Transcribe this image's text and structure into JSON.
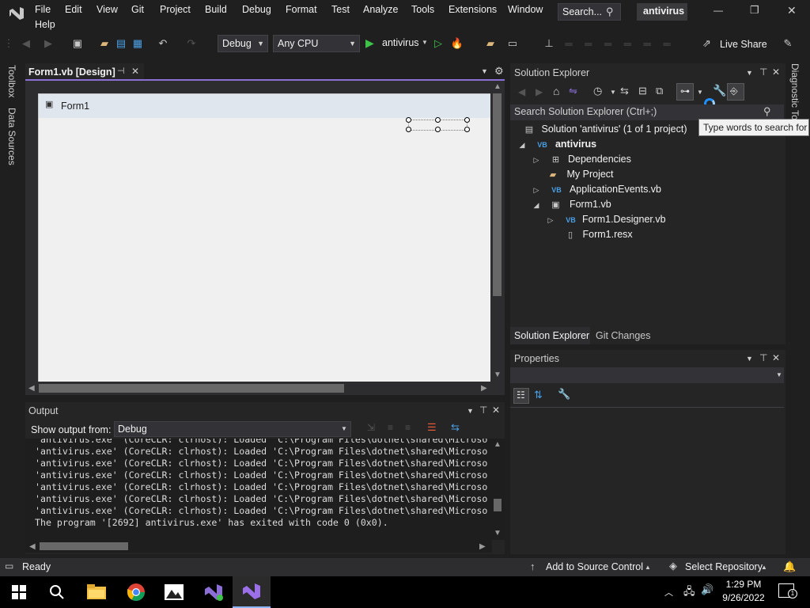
{
  "menu": [
    "File",
    "Edit",
    "View",
    "Git",
    "Project",
    "Build",
    "Debug",
    "Format",
    "Test",
    "Analyze",
    "Tools",
    "Extensions",
    "Window",
    "Help"
  ],
  "search": {
    "label": "Search..."
  },
  "solution_name": "antivirus",
  "window_controls": {
    "minimize": "—",
    "restore": "❐",
    "close": "✕"
  },
  "toolbar": {
    "config": "Debug",
    "platform": "Any CPU",
    "start": "antivirus",
    "live_share": "Live Share"
  },
  "side_tabs_left": [
    "Toolbox",
    "Data Sources"
  ],
  "side_tab_right": "Diagnostic To",
  "doc_tab": {
    "title": "Form1.vb [Design]",
    "pin": "⊣",
    "close": "✕"
  },
  "form_designer": {
    "form_title": "Form1"
  },
  "output": {
    "title": "Output",
    "show_from_label": "Show output from:",
    "source": "Debug",
    "lines": [
      "'antivirus.exe' (CoreCLR: clrhost): Loaded 'C:\\Program Files\\dotnet\\shared\\Microso",
      "'antivirus.exe' (CoreCLR: clrhost): Loaded 'C:\\Program Files\\dotnet\\shared\\Microso",
      "'antivirus.exe' (CoreCLR: clrhost): Loaded 'C:\\Program Files\\dotnet\\shared\\Microso",
      "'antivirus.exe' (CoreCLR: clrhost): Loaded 'C:\\Program Files\\dotnet\\shared\\Microso",
      "'antivirus.exe' (CoreCLR: clrhost): Loaded 'C:\\Program Files\\dotnet\\shared\\Microso",
      "'antivirus.exe' (CoreCLR: clrhost): Loaded 'C:\\Program Files\\dotnet\\shared\\Microso",
      "'antivirus.exe' (CoreCLR: clrhost): Loaded 'C:\\Program Files\\dotnet\\shared\\Microso",
      "The program '[2692] antivirus.exe' has exited with code 0 (0x0)."
    ]
  },
  "solution_explorer": {
    "title": "Solution Explorer",
    "search_placeholder": "Search Solution Explorer (Ctrl+;)",
    "tooltip": "Type words to search for",
    "solution_label": "Solution 'antivirus' (1 of 1 project)",
    "project": "antivirus",
    "items": [
      {
        "label": "Dependencies",
        "icon": "dependencies-icon"
      },
      {
        "label": "My Project",
        "icon": "folder-icon"
      },
      {
        "label": "ApplicationEvents.vb",
        "icon": "vb-file-icon"
      },
      {
        "label": "Form1.vb",
        "icon": "form-icon"
      },
      {
        "label": "Form1.Designer.vb",
        "icon": "vb-file-icon"
      },
      {
        "label": "Form1.resx",
        "icon": "resx-icon"
      }
    ],
    "bottom_tabs": [
      "Solution Explorer",
      "Git Changes"
    ]
  },
  "properties": {
    "title": "Properties"
  },
  "status_bar": {
    "ready": "Ready",
    "source_control": "Add to Source Control",
    "repository": "Select Repository"
  },
  "taskbar": {
    "time": "1:29 PM",
    "date": "9/26/2022",
    "notification_count": "1"
  },
  "colors": {
    "accent": "#8c6fd6",
    "bg": "#1f1f1f",
    "panel": "#252526",
    "statusbar": "#2d2d30"
  }
}
